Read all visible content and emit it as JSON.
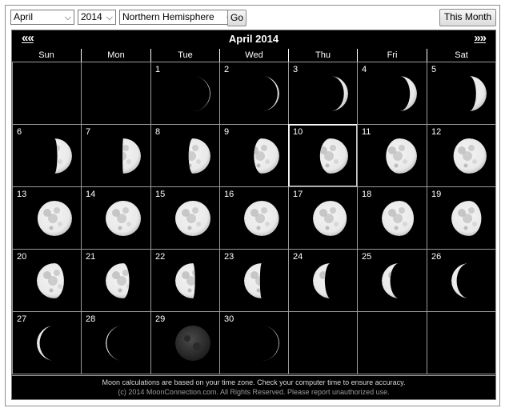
{
  "controls": {
    "month": "April",
    "year": "2014",
    "hemisphere": "Northern Hemisphere",
    "go_label": "Go",
    "this_month_label": "This Month"
  },
  "calendar": {
    "title": "April 2014",
    "prev_label": "««",
    "next_label": "»»",
    "weekdays": [
      "Sun",
      "Mon",
      "Tue",
      "Wed",
      "Thu",
      "Fri",
      "Sat"
    ],
    "today": 10,
    "days": [
      {
        "day": "1",
        "illum": 0.02,
        "side": "right"
      },
      {
        "day": "2",
        "illum": 0.05,
        "side": "right"
      },
      {
        "day": "3",
        "illum": 0.12,
        "side": "right"
      },
      {
        "day": "4",
        "illum": 0.2,
        "side": "right"
      },
      {
        "day": "5",
        "illum": 0.3,
        "side": "right"
      },
      {
        "day": "6",
        "illum": 0.42,
        "side": "right"
      },
      {
        "day": "7",
        "illum": 0.52,
        "side": "right"
      },
      {
        "day": "8",
        "illum": 0.62,
        "side": "right"
      },
      {
        "day": "9",
        "illum": 0.72,
        "side": "right"
      },
      {
        "day": "10",
        "illum": 0.8,
        "side": "right"
      },
      {
        "day": "11",
        "illum": 0.88,
        "side": "right"
      },
      {
        "day": "12",
        "illum": 0.94,
        "side": "right"
      },
      {
        "day": "13",
        "illum": 0.98,
        "side": "right"
      },
      {
        "day": "14",
        "illum": 1.0,
        "side": "right"
      },
      {
        "day": "15",
        "illum": 1.0,
        "side": "left"
      },
      {
        "day": "16",
        "illum": 0.99,
        "side": "left"
      },
      {
        "day": "17",
        "illum": 0.96,
        "side": "left"
      },
      {
        "day": "18",
        "illum": 0.91,
        "side": "left"
      },
      {
        "day": "19",
        "illum": 0.85,
        "side": "left"
      },
      {
        "day": "20",
        "illum": 0.77,
        "side": "left"
      },
      {
        "day": "21",
        "illum": 0.67,
        "side": "left"
      },
      {
        "day": "22",
        "illum": 0.56,
        "side": "left"
      },
      {
        "day": "23",
        "illum": 0.45,
        "side": "left"
      },
      {
        "day": "24",
        "illum": 0.34,
        "side": "left"
      },
      {
        "day": "25",
        "illum": 0.24,
        "side": "left"
      },
      {
        "day": "26",
        "illum": 0.15,
        "side": "left"
      },
      {
        "day": "27",
        "illum": 0.08,
        "side": "left"
      },
      {
        "day": "28",
        "illum": 0.03,
        "side": "left"
      },
      {
        "day": "29",
        "illum": 0.0,
        "side": "new"
      },
      {
        "day": "30",
        "illum": 0.02,
        "side": "right"
      }
    ],
    "first_weekday": 2
  },
  "footer": {
    "line1": "Moon calculations are based on your time zone. Check your computer time to ensure accuracy.",
    "line2": "(c) 2014 MoonConnection.com. All Rights Reserved. Please report unauthorized use."
  },
  "colors": {
    "moon_light": "#e9e9e9",
    "moon_dark": "#0a0a0a",
    "new_moon": "#3a3a3a"
  }
}
